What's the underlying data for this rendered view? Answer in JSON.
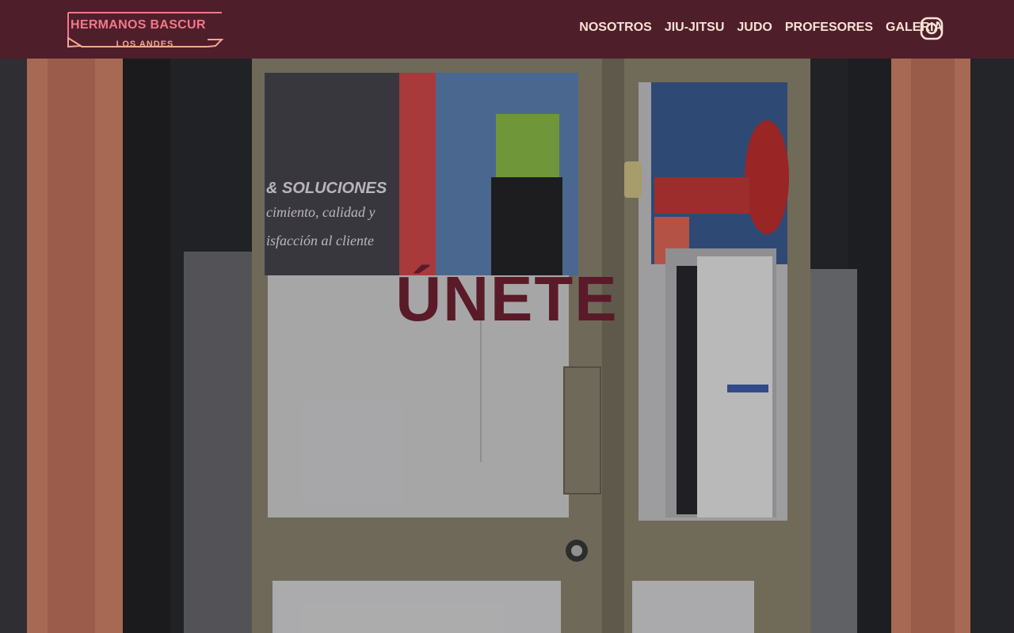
{
  "brand": {
    "title": "HERMANOS BASCUR",
    "subtitle": "LOS ANDES",
    "accent_color": "#f2788a",
    "nav_bg_color": "#4f1e2b"
  },
  "nav": {
    "items": [
      {
        "label": "NOSOTROS"
      },
      {
        "label": "JIU-JITSU"
      },
      {
        "label": "JUDO"
      },
      {
        "label": "PROFESORES"
      },
      {
        "label": "GALERIA"
      }
    ],
    "social_icon": "instagram-icon"
  },
  "hero": {
    "title": "ÚNETE",
    "title_color": "#5a1a28",
    "image_subject": "gym-entrance-glass-doors",
    "door_poster_text": {
      "line1": "& SOLUCIONES",
      "line2": "cimiento, calidad y",
      "line3": "isfacción al cliente"
    }
  }
}
